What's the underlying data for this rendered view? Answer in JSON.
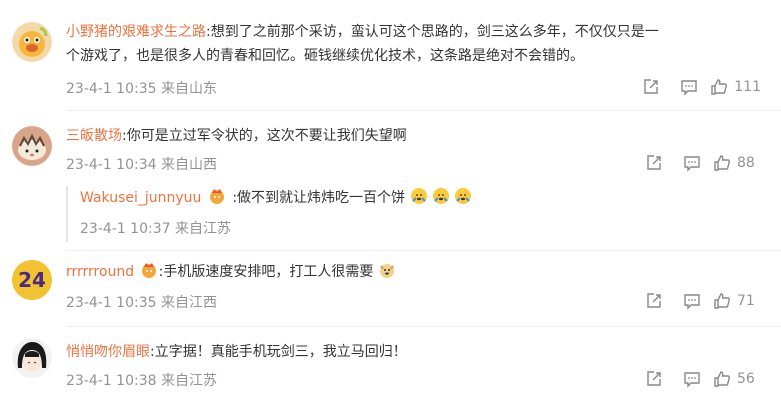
{
  "comments": [
    {
      "username": "小野猪的艰难求生之路",
      "text": ":想到了之前那个采访，蛮认可这个思路的，剑三这么多年，不仅仅只是一个游戏了，也是很多人的青春和回忆。砸钱继续优化技术，这条路是绝对不会错的。",
      "line1": ":想到了之前那个采访，蛮认可这个思路的，剑三这么多年，不仅仅只是一",
      "line2": "个游戏了，也是很多人的青春和回忆。砸钱继续优化技术，这条路是绝对不会错的。",
      "time": "23-4-1 10:35 来自山东",
      "likes": "111"
    },
    {
      "username": "三皈散场",
      "text": ":你可是立过军令状的，这次不要让我们失望啊",
      "time": "23-4-1 10:34 来自山西",
      "likes": "88",
      "reply": {
        "username": "Wakusei_junnyuu",
        "text": ":做不到就让炜炜吃一百个饼",
        "time": "23-4-1 10:37 来自江苏"
      }
    },
    {
      "username": "rrrrrround",
      "avatar_text": "24",
      "text": ":手机版速度安排吧，打工人很需要",
      "time": "23-4-1 10:35 来自江西",
      "likes": "71"
    },
    {
      "username": "悄悄吻你眉眼",
      "text": ":立字据！真能手机玩剑三，我立马回归！",
      "time": "23-4-1 10:38 来自江苏",
      "likes": "56"
    }
  ],
  "colors": {
    "username": "#eb7340",
    "meta": "#939393",
    "text": "#333333"
  }
}
